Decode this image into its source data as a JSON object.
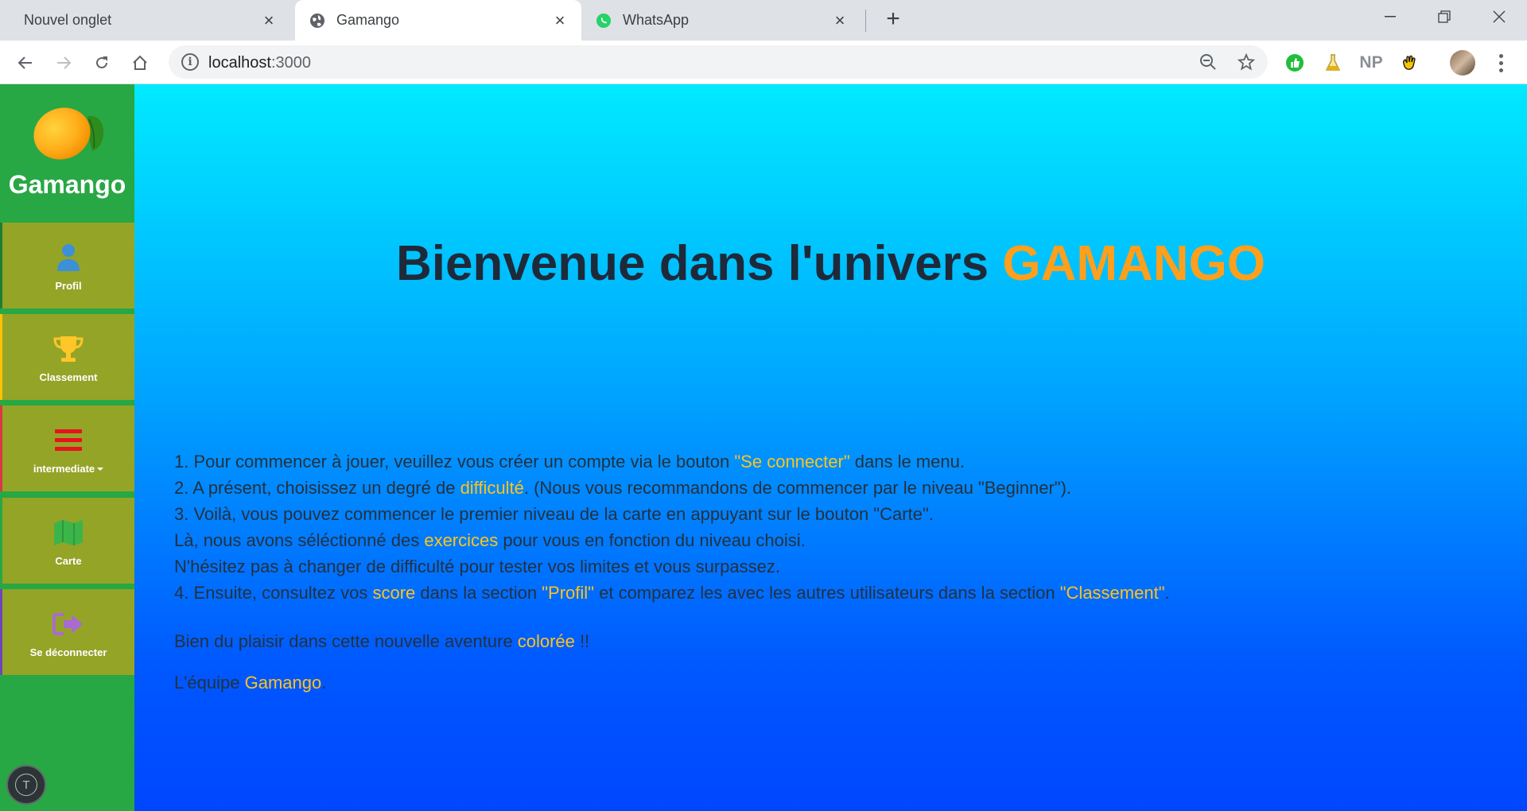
{
  "browser": {
    "tabs": [
      {
        "title": "Nouvel onglet",
        "active": false
      },
      {
        "title": "Gamango",
        "active": true
      },
      {
        "title": "WhatsApp",
        "active": false
      }
    ],
    "url": {
      "host": "localhost",
      "port": ":3000"
    },
    "extensions": [
      "green-thumb-icon",
      "flask-icon",
      "np-icon",
      "hand-icon"
    ],
    "np_label": "NP"
  },
  "app": {
    "brand": "Gamango",
    "nav": [
      {
        "label": "Profil",
        "icon": "user-icon"
      },
      {
        "label": "Classement",
        "icon": "trophy-icon"
      },
      {
        "label": "intermediate",
        "icon": "bars-icon"
      },
      {
        "label": "Carte",
        "icon": "map-icon"
      },
      {
        "label": "Se déconnecter",
        "icon": "sign-out-icon"
      }
    ],
    "badge": "T",
    "headline": {
      "text": "Bienvenue dans l'univers ",
      "accent": "GAMANGO"
    },
    "instructions": {
      "l1": {
        "a": "1. Pour commencer à jouer, veuillez vous créer un compte via le bouton ",
        "hl": "\"Se connecter\"",
        "b": " dans le menu."
      },
      "l2": {
        "a": "2. A présent, choisissez un degré de ",
        "hl": "difficulté",
        "b": ". (Nous vous recommandons de commencer par le niveau \"Beginner\")."
      },
      "l3": "3. Voilà, vous pouvez commencer le premier niveau de la carte en appuyant sur le bouton \"Carte\".",
      "l4": {
        "a": "Là, nous avons séléctionné des ",
        "hl": "exercices",
        "b": " pour vous en fonction du niveau choisi."
      },
      "l5": "N'hésitez pas à changer de difficulté pour tester vos limites et vous surpassez.",
      "l6": {
        "a": "4. Ensuite, consultez vos ",
        "hl1": "score",
        "b": " dans la section ",
        "hl2": "\"Profil\"",
        "c": " et comparez les avec les autres utilisateurs dans la section ",
        "hl3": "\"Classement\"",
        "d": "."
      }
    },
    "plaisir": {
      "a": "Bien du plaisir dans cette nouvelle aventure ",
      "hl": "colorée",
      "b": " !!"
    },
    "signature": {
      "a": "L'équipe ",
      "hl": "Gamango",
      "b": "."
    },
    "colors": {
      "accent": "#ff9f1c",
      "highlight": "#ffc41a",
      "sidebar": "#28a745",
      "nav_item": "#94a427"
    }
  }
}
